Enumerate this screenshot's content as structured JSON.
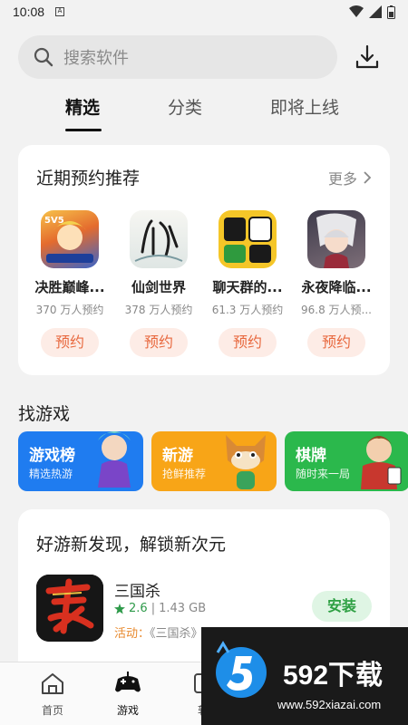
{
  "status_bar": {
    "time": "10:08",
    "notification_icon": "a-icon"
  },
  "search": {
    "placeholder": "搜索软件"
  },
  "tabs": [
    {
      "label": "精选",
      "active": true
    },
    {
      "label": "分类",
      "active": false
    },
    {
      "label": "即将上线",
      "active": false
    }
  ],
  "reserve_section": {
    "title": "近期预约推荐",
    "more_label": "更多",
    "apps": [
      {
        "name": "决胜巅峰...",
        "count": "370 万人预约",
        "button": "预约"
      },
      {
        "name": "仙剑世界",
        "count": "378 万人预约",
        "button": "预约"
      },
      {
        "name": "聊天群的...",
        "count": "61.3 万人预约",
        "button": "预约"
      },
      {
        "name": "永夜降临...",
        "count": "96.8 万人预...",
        "button": "预约"
      }
    ]
  },
  "find_games": {
    "title": "找游戏",
    "categories": [
      {
        "title": "游戏榜",
        "subtitle": "精选热游",
        "color": "#1f7cf0"
      },
      {
        "title": "新游",
        "subtitle": "抢鲜推荐",
        "color": "#f8a517"
      },
      {
        "title": "棋牌",
        "subtitle": "随时来一局",
        "color": "#2bb84c"
      }
    ]
  },
  "discover": {
    "title": "好游新发现，解锁新次元",
    "game": {
      "name": "三国杀",
      "rating": "2.6",
      "size": "1.43 GB",
      "activity_tag": "活动：",
      "activity_text": "《三国杀》...",
      "install_label": "安装"
    }
  },
  "bottom_nav": [
    {
      "label": "首页",
      "icon": "home-icon",
      "active": false
    },
    {
      "label": "游戏",
      "icon": "gamepad-icon",
      "active": true
    },
    {
      "label": "软",
      "icon": "software-icon",
      "active": false
    }
  ],
  "watermark": {
    "brand": "592下载",
    "url": "www.592xiazai.com"
  }
}
